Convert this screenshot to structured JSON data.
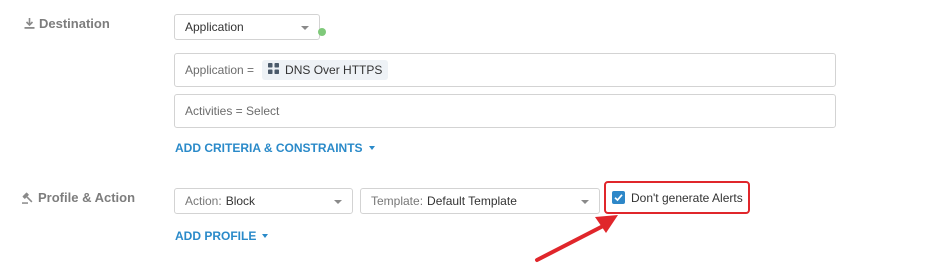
{
  "destination": {
    "label": "Destination",
    "type_dropdown": "Application",
    "application_field": {
      "prefix": "Application =",
      "chip": "DNS Over HTTPS"
    },
    "activities_field": "Activities = Select",
    "add_criteria_link": "ADD CRITERIA & CONSTRAINTS"
  },
  "profile_action": {
    "label": "Profile & Action",
    "action_dropdown": {
      "prefix": "Action:",
      "value": "Block"
    },
    "template_dropdown": {
      "prefix": "Template:",
      "value": "Default Template"
    },
    "alerts_checkbox": {
      "label": "Don't generate Alerts",
      "checked": true
    },
    "add_profile_link": "ADD PROFILE"
  },
  "colors": {
    "accent": "#2a8ac9",
    "highlight_red": "#e0262b",
    "status_green": "#7fc97a"
  },
  "icons": {
    "destination": "download-icon",
    "profile_action": "gavel-icon",
    "chip": "app-grid-icon"
  }
}
